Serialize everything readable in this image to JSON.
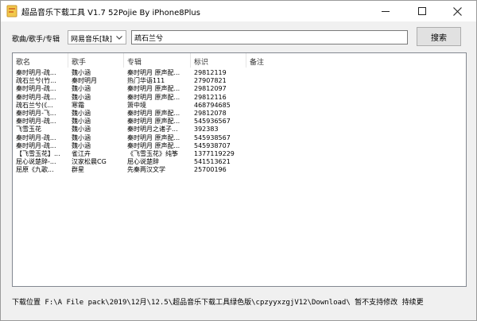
{
  "window": {
    "title": "超品音乐下载工具 V1.7 52Pojie By iPhone8Plus",
    "minimize": "–",
    "maximize": "□",
    "close": "✕"
  },
  "search": {
    "label": "歌曲/歌手/专辑",
    "source_value": "网易音乐[缺]",
    "query": "疏石兰兮",
    "button_label": "搜索"
  },
  "table": {
    "columns": [
      "歌名",
      "歌手",
      "专辑",
      "标识",
      "备注"
    ],
    "rows": [
      [
        "秦时明月-疏...",
        "魏小涵",
        "秦时明月 原声配...",
        "29812119",
        ""
      ],
      [
        "疏石兰兮(竹...",
        "秦时明月",
        "热门华语111",
        "27907821",
        ""
      ],
      [
        "秦时明月-疏...",
        "魏小涵",
        "秦时明月 原声配...",
        "29812097",
        ""
      ],
      [
        "秦时明月-疏...",
        "魏小涵",
        "秦时明月 原声配...",
        "29812116",
        ""
      ],
      [
        "疏石兰兮(《...",
        "寒霜",
        "箫中境",
        "468794685",
        ""
      ],
      [
        "秦时明月-飞...",
        "魏小涵",
        "秦时明月 原声配...",
        "29812078",
        ""
      ],
      [
        "秦时明月-疏...",
        "魏小涵",
        "秦时明月 原声配...",
        "545936567",
        ""
      ],
      [
        "飞雪玉花",
        "魏小涵",
        "秦时明月之诸子...",
        "392383",
        ""
      ],
      [
        "秦时明月-疏...",
        "魏小涵",
        "秦时明月 原声配...",
        "545938567",
        ""
      ],
      [
        "秦时明月-疏...",
        "魏小涵",
        "秦时明月 原声配...",
        "545938707",
        ""
      ],
      [
        "【飞雪玉花】...",
        "雀江卉",
        "《飞雪玉花》纯筝",
        "1377119229",
        ""
      ],
      [
        "屈心说楚辞-...",
        "汉家松晨CG",
        "屈心说楚辞",
        "541513621",
        ""
      ],
      [
        "屈原《九歌...",
        "群星",
        "先秦两汉文学",
        "25700196",
        ""
      ]
    ]
  },
  "status": {
    "text": "下载位置 F:\\A File pack\\2019\\12月\\12.5\\超品音乐下载工具绿色版\\cpzyyxzgjV12\\Download\\ 暂不支持修改 持续更"
  }
}
